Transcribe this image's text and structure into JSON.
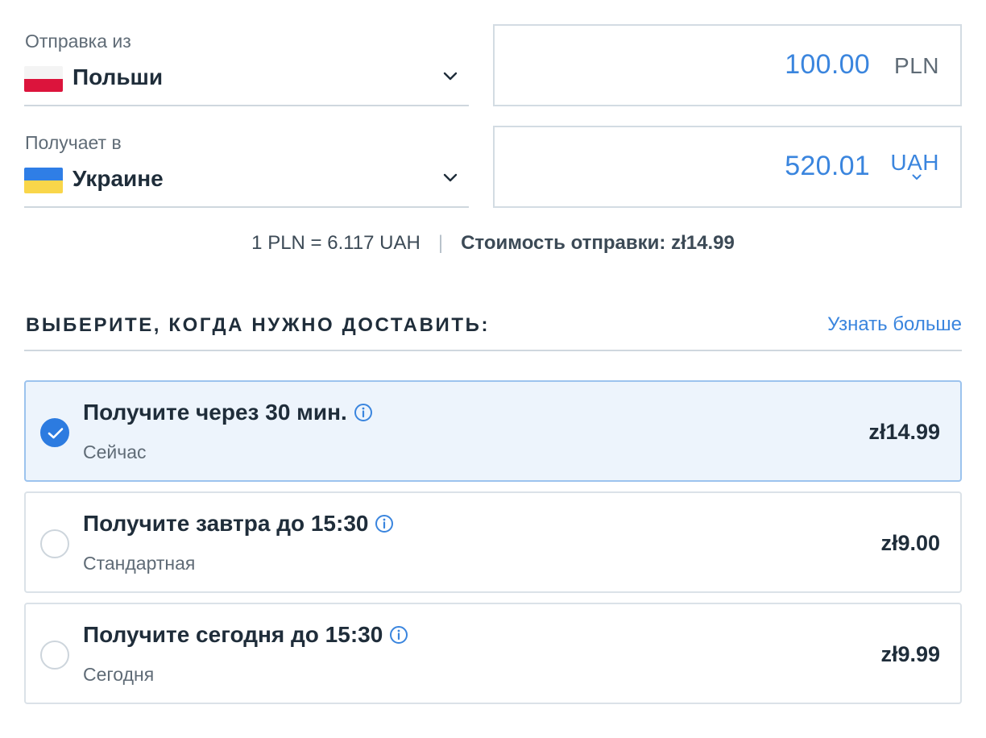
{
  "transfer": {
    "send": {
      "label": "Отправка из",
      "country": "Польши",
      "flag": "poland-flag-icon",
      "amount": "100.00",
      "currency": "PLN"
    },
    "receive": {
      "label": "Получает в",
      "country": "Украине",
      "flag": "ukraine-flag-icon",
      "amount": "520.01",
      "currency": "UAH"
    }
  },
  "rate_info": {
    "rate": "1 PLN = 6.117 UAH",
    "separator": "|",
    "fee_label": "Стоимость отправки:",
    "fee_value": "zł14.99"
  },
  "delivery": {
    "title": "ВЫБЕРИТЕ, КОГДА НУЖНО ДОСТАВИТЬ:",
    "learn_more": "Узнать больше",
    "options": [
      {
        "title": "Получите через 30 мин.",
        "subtitle": "Сейчас",
        "price": "zł14.99",
        "selected": true
      },
      {
        "title": "Получите завтра до 15:30",
        "subtitle": "Стандартная",
        "price": "zł9.00",
        "selected": false
      },
      {
        "title": "Получите сегодня до 15:30",
        "subtitle": "Сегодня",
        "price": "zł9.99",
        "selected": false
      }
    ]
  },
  "colors": {
    "accent": "#3a85de",
    "selected_bg": "#edf4fc",
    "radio_checked": "#2c7be0",
    "text_dark": "#1f2d3a",
    "text_muted": "#5f6b76",
    "border": "#cfd7de"
  }
}
